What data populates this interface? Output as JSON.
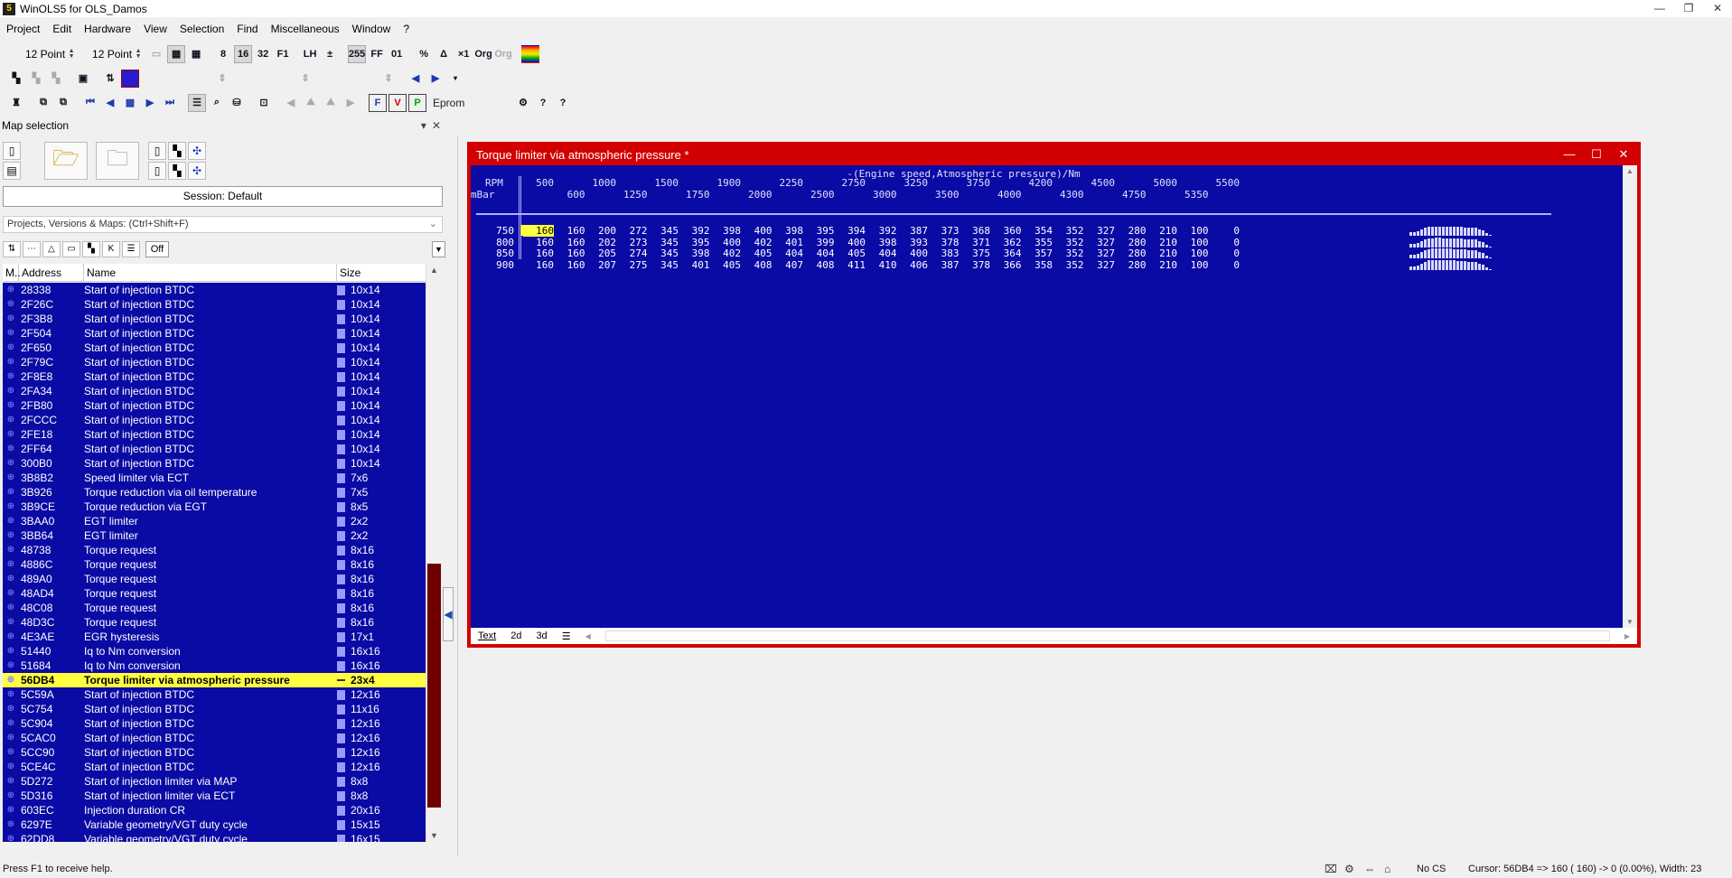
{
  "titlebar": {
    "title": "WinOLS5 for OLS_Damos"
  },
  "menu": [
    "Project",
    "Edit",
    "Hardware",
    "View",
    "Selection",
    "Find",
    "Miscellaneous",
    "Window",
    "?"
  ],
  "toolbar": {
    "font_size_1": "12 Point",
    "font_size_2": "12 Point",
    "eprom_label": "Eprom"
  },
  "left_panel": {
    "header": "Map selection",
    "session": "Session: Default",
    "projects_search": "Projects, Versions & Maps:  (Ctrl+Shift+F)",
    "filter_off": "Off",
    "columns": {
      "m": "M..",
      "address": "Address",
      "name": "Name",
      "size": "Size"
    },
    "rows": [
      {
        "addr": "28338",
        "name": "Start of injection BTDC",
        "size": "10x14"
      },
      {
        "addr": "2F26C",
        "name": "Start of injection BTDC",
        "size": "10x14"
      },
      {
        "addr": "2F3B8",
        "name": "Start of injection BTDC",
        "size": "10x14"
      },
      {
        "addr": "2F504",
        "name": "Start of injection BTDC",
        "size": "10x14"
      },
      {
        "addr": "2F650",
        "name": "Start of injection BTDC",
        "size": "10x14"
      },
      {
        "addr": "2F79C",
        "name": "Start of injection BTDC",
        "size": "10x14"
      },
      {
        "addr": "2F8E8",
        "name": "Start of injection BTDC",
        "size": "10x14"
      },
      {
        "addr": "2FA34",
        "name": "Start of injection BTDC",
        "size": "10x14"
      },
      {
        "addr": "2FB80",
        "name": "Start of injection BTDC",
        "size": "10x14"
      },
      {
        "addr": "2FCCC",
        "name": "Start of injection BTDC",
        "size": "10x14"
      },
      {
        "addr": "2FE18",
        "name": "Start of injection BTDC",
        "size": "10x14"
      },
      {
        "addr": "2FF64",
        "name": "Start of injection BTDC",
        "size": "10x14"
      },
      {
        "addr": "300B0",
        "name": "Start of injection BTDC",
        "size": "10x14"
      },
      {
        "addr": "3B8B2",
        "name": "Speed limiter via ECT",
        "size": "7x6"
      },
      {
        "addr": "3B926",
        "name": "Torque reduction via oil temperature",
        "size": "7x5"
      },
      {
        "addr": "3B9CE",
        "name": "Torque reduction via EGT",
        "size": "8x5"
      },
      {
        "addr": "3BAA0",
        "name": "EGT limiter",
        "size": "2x2"
      },
      {
        "addr": "3BB64",
        "name": "EGT limiter",
        "size": "2x2"
      },
      {
        "addr": "48738",
        "name": "Torque request",
        "size": "8x16"
      },
      {
        "addr": "4886C",
        "name": "Torque request",
        "size": "8x16"
      },
      {
        "addr": "489A0",
        "name": "Torque request",
        "size": "8x16"
      },
      {
        "addr": "48AD4",
        "name": "Torque request",
        "size": "8x16"
      },
      {
        "addr": "48C08",
        "name": "Torque request",
        "size": "8x16"
      },
      {
        "addr": "48D3C",
        "name": "Torque request",
        "size": "8x16"
      },
      {
        "addr": "4E3AE",
        "name": "EGR hysteresis",
        "size": "17x1"
      },
      {
        "addr": "51440",
        "name": "Iq to Nm conversion",
        "size": "16x16"
      },
      {
        "addr": "51684",
        "name": "Iq to Nm conversion",
        "size": "16x16"
      },
      {
        "addr": "56DB4",
        "name": "Torque limiter via atmospheric pressure",
        "size": "23x4",
        "selected": true
      },
      {
        "addr": "5C59A",
        "name": "Start of injection BTDC",
        "size": "12x16"
      },
      {
        "addr": "5C754",
        "name": "Start of injection BTDC",
        "size": "11x16"
      },
      {
        "addr": "5C904",
        "name": "Start of injection BTDC",
        "size": "12x16"
      },
      {
        "addr": "5CAC0",
        "name": "Start of injection BTDC",
        "size": "12x16"
      },
      {
        "addr": "5CC90",
        "name": "Start of injection BTDC",
        "size": "12x16"
      },
      {
        "addr": "5CE4C",
        "name": "Start of injection BTDC",
        "size": "12x16"
      },
      {
        "addr": "5D272",
        "name": "Start of injection limiter via MAP",
        "size": "8x8"
      },
      {
        "addr": "5D316",
        "name": "Start of injection limiter via ECT",
        "size": "8x8"
      },
      {
        "addr": "603EC",
        "name": "Injection duration CR",
        "size": "20x16"
      },
      {
        "addr": "6297E",
        "name": "Variable geometry/VGT duty cycle",
        "size": "15x15"
      },
      {
        "addr": "62DD8",
        "name": "Variable geometry/VGT duty cycle",
        "size": "16x15"
      }
    ]
  },
  "map_window": {
    "title": "Torque limiter via atmospheric pressure *",
    "caption": "-(Engine speed,Atmospheric pressure)/Nm",
    "x_unit": "RPM",
    "y_unit": "mBar",
    "x_axis": [
      "500",
      "600",
      "1000",
      "1250",
      "1500",
      "1750",
      "1900",
      "2000",
      "2250",
      "2500",
      "2750",
      "3000",
      "3250",
      "3500",
      "3750",
      "4000",
      "4200",
      "4300",
      "4500",
      "4750",
      "5000",
      "5350",
      "5500"
    ],
    "y_axis": [
      "750",
      "800",
      "850",
      "900"
    ],
    "values": [
      [
        "160",
        "160",
        "200",
        "272",
        "345",
        "392",
        "398",
        "400",
        "398",
        "395",
        "394",
        "392",
        "387",
        "373",
        "368",
        "360",
        "354",
        "352",
        "327",
        "280",
        "210",
        "100",
        "0"
      ],
      [
        "160",
        "160",
        "202",
        "273",
        "345",
        "395",
        "400",
        "402",
        "401",
        "399",
        "400",
        "398",
        "393",
        "378",
        "371",
        "362",
        "355",
        "352",
        "327",
        "280",
        "210",
        "100",
        "0"
      ],
      [
        "160",
        "160",
        "205",
        "274",
        "345",
        "398",
        "402",
        "405",
        "404",
        "404",
        "405",
        "404",
        "400",
        "383",
        "375",
        "364",
        "357",
        "352",
        "327",
        "280",
        "210",
        "100",
        "0"
      ],
      [
        "160",
        "160",
        "207",
        "275",
        "345",
        "401",
        "405",
        "408",
        "407",
        "408",
        "411",
        "410",
        "406",
        "387",
        "378",
        "366",
        "358",
        "352",
        "327",
        "280",
        "210",
        "100",
        "0"
      ]
    ],
    "tabs": [
      "Text",
      "2d",
      "3d"
    ]
  },
  "status": {
    "help": "Press F1 to receive help.",
    "checksum": "No CS",
    "cursor": "Cursor: 56DB4 =>   160 (  160) ->      0 (0.00%), Width: 23"
  },
  "colors": {
    "map_bg": "#0a0aa5",
    "window_border": "#d20000",
    "selection": "#ffff40"
  }
}
